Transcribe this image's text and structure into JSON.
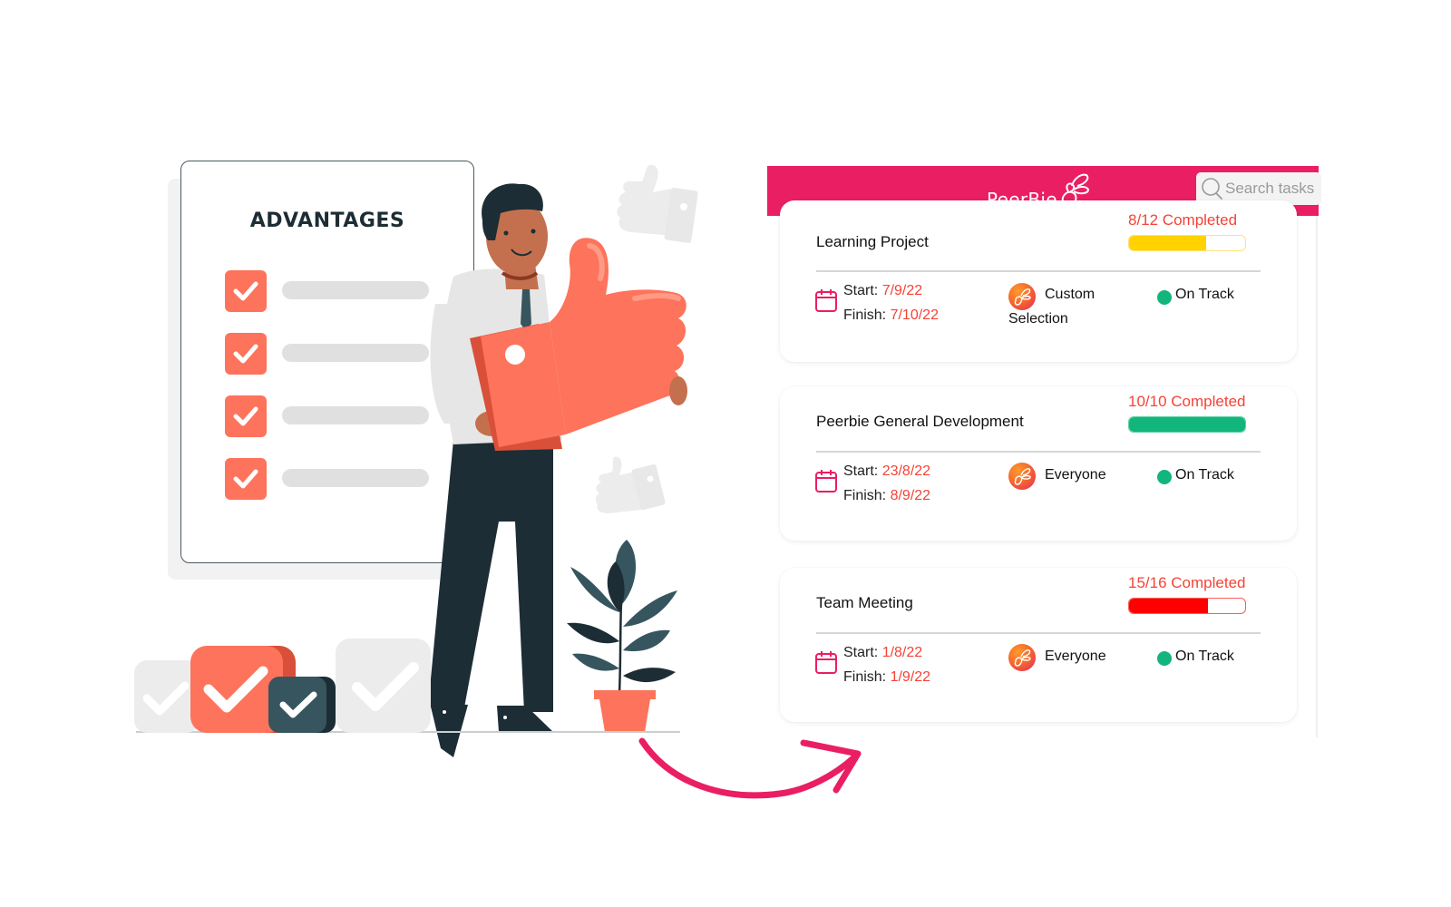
{
  "illustration": {
    "board_title": "ADVANTAGES",
    "checklist_items": 4,
    "colors": {
      "accent": "#fd735b",
      "dark": "#1d2d35",
      "teal": "#37555e",
      "muted": "#e0e0e0",
      "arrow": "#ea1e63"
    }
  },
  "app": {
    "brand": "PeerBie",
    "brand_color": "#ea1e63",
    "search": {
      "placeholder": "Search tasks",
      "value": ""
    },
    "projects": [
      {
        "title": "Learning Project",
        "completed": 8,
        "total": 12,
        "progress_label": "8/12 Completed",
        "progress_fraction": 0.667,
        "progress_color": "#ffd200",
        "progress_border": "#ffe27a",
        "start_label": "Start:",
        "start": "7/9/22",
        "finish_label": "Finish:",
        "finish": "7/10/22",
        "assignee": "Custom Selection",
        "status": "On Track",
        "status_color": "#12b57c"
      },
      {
        "title": "Peerbie General Development",
        "completed": 10,
        "total": 10,
        "progress_label": "10/10 Completed",
        "progress_fraction": 1.0,
        "progress_color": "#12b57c",
        "progress_border": "#5fd3a6",
        "start_label": "Start:",
        "start": "23/8/22",
        "finish_label": "Finish:",
        "finish": "8/9/22",
        "assignee": "Everyone",
        "status": "On Track",
        "status_color": "#12b57c"
      },
      {
        "title": "Team Meeting",
        "completed": 15,
        "total": 16,
        "progress_label": "15/16 Completed",
        "progress_fraction": 0.68,
        "progress_color": "#ff0000",
        "progress_border": "#ff5a5a",
        "start_label": "Start:",
        "start": "1/8/22",
        "finish_label": "Finish:",
        "finish": "1/9/22",
        "assignee": "Everyone",
        "status": "On Track",
        "status_color": "#12b57c"
      }
    ]
  }
}
